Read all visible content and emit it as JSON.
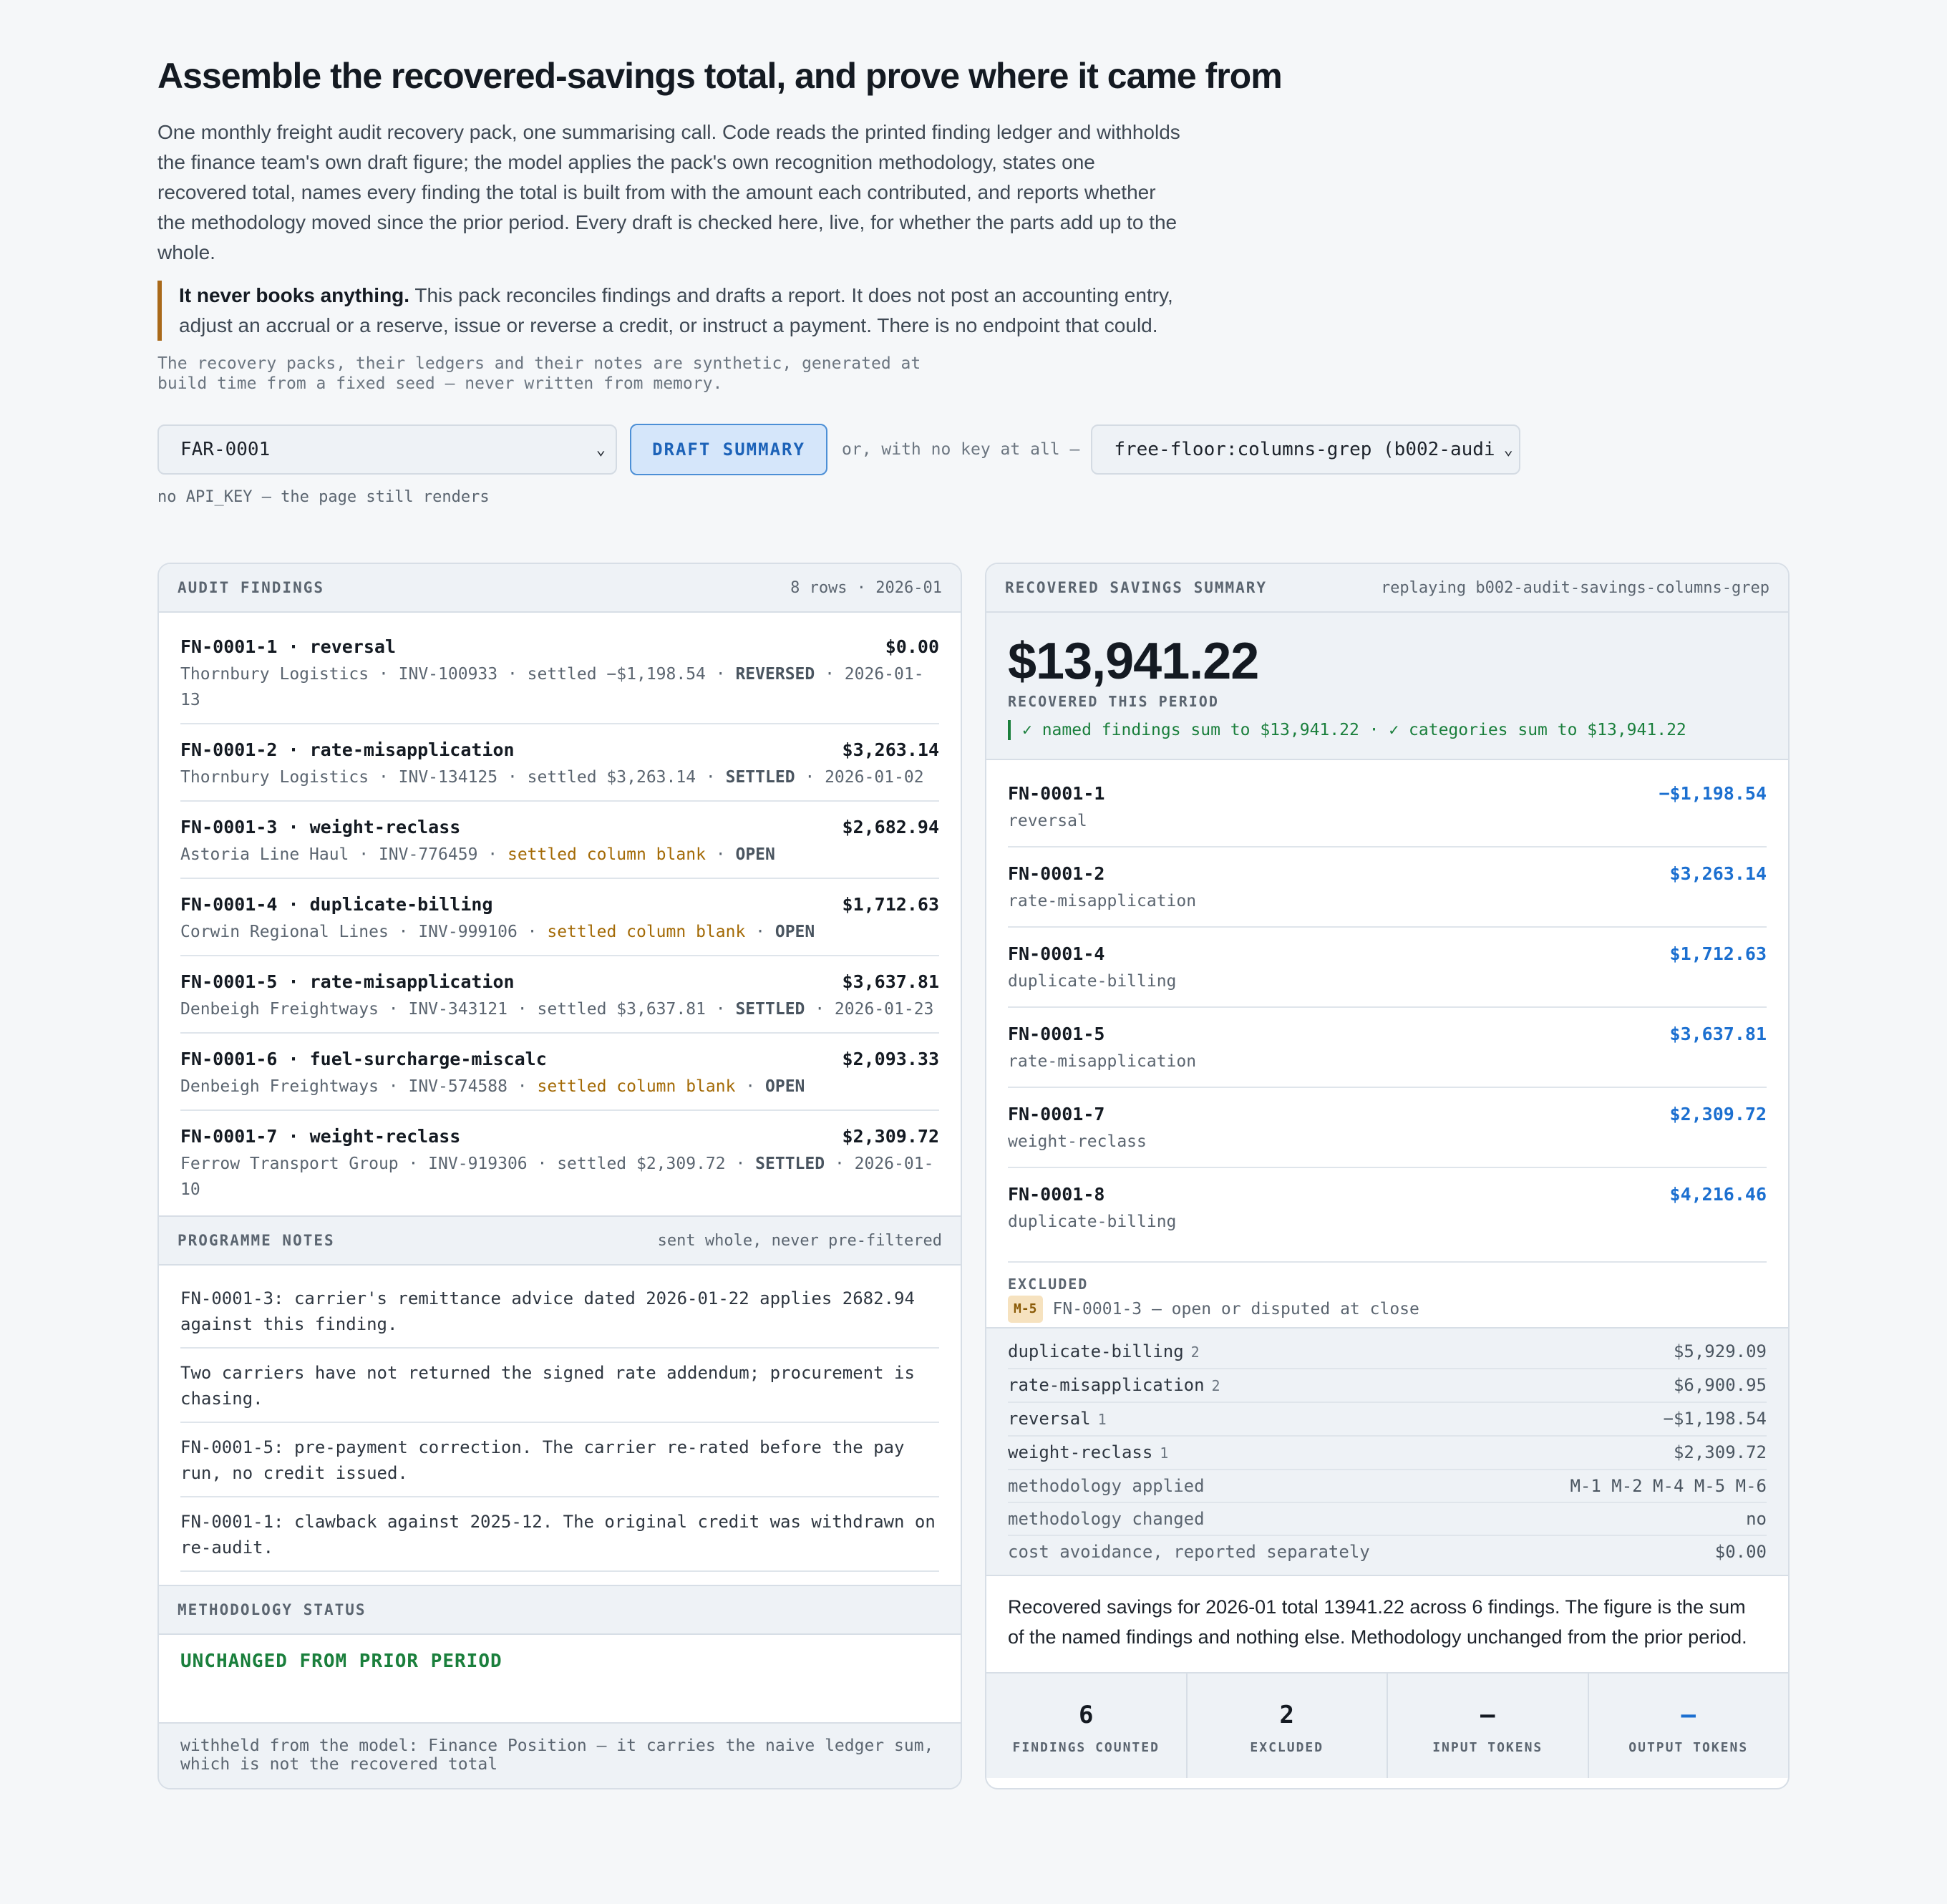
{
  "header": {
    "title": "Assemble the recovered-savings total, and prove where it came from",
    "intro": "One monthly freight audit recovery pack, one summarising call. Code reads the printed finding ledger and withholds the finance team's own draft figure; the model applies the pack's own recognition methodology, states one recovered total, names every finding the total is built from with the amount each contributed, and reports whether the methodology moved since the prior period. Every draft is checked here, live, for whether the parts add up to the whole.",
    "callout_bold": "It never books anything.",
    "callout_text": "This pack reconciles findings and drafts a report. It does not post an accounting entry, adjust an accrual or a reserve, issue or reverse a credit, or instruct a payment. There is no endpoint that could.",
    "seed_note": "The recovery packs, their ledgers and their notes are synthetic, generated at build time from a fixed seed — never written from memory."
  },
  "controls": {
    "pack_select": "FAR-0001",
    "draft_button": "DRAFT SUMMARY",
    "or_text": "or, with no key at all —",
    "replay_select": "free-floor:columns-grep (b002-audi",
    "no_key_note": "no API_KEY — the page still renders"
  },
  "findings": {
    "title": "AUDIT FINDINGS",
    "meta": "8 rows · 2026-01",
    "rows": [
      {
        "id_cat": "FN-0001-1 · reversal",
        "amount": "$0.00",
        "carrier": "Thornbury Logistics · INV-100933 · ",
        "settled": "settled −$1,198.54",
        "sep": " · ",
        "status": "REVERSED",
        "date": " · 2026-01-13"
      },
      {
        "id_cat": "FN-0001-2 · rate-misapplication",
        "amount": "$3,263.14",
        "carrier": "Thornbury Logistics · INV-134125 · ",
        "settled": "settled $3,263.14",
        "sep": " · ",
        "status": "SETTLED",
        "date": " · 2026-01-02"
      },
      {
        "id_cat": "FN-0001-3 · weight-reclass",
        "amount": "$2,682.94",
        "carrier": "Astoria Line Haul · INV-776459 · ",
        "blank": "settled column blank",
        "sep": " · ",
        "status": "OPEN",
        "date": ""
      },
      {
        "id_cat": "FN-0001-4 · duplicate-billing",
        "amount": "$1,712.63",
        "carrier": "Corwin Regional Lines · INV-999106 · ",
        "blank": "settled column blank",
        "sep": " · ",
        "status": "OPEN",
        "date": ""
      },
      {
        "id_cat": "FN-0001-5 · rate-misapplication",
        "amount": "$3,637.81",
        "carrier": "Denbeigh Freightways · INV-343121 · ",
        "settled": "settled $3,637.81",
        "sep": " · ",
        "status": "SETTLED",
        "date": " · 2026-01-23"
      },
      {
        "id_cat": "FN-0001-6 · fuel-surcharge-miscalc",
        "amount": "$2,093.33",
        "carrier": "Denbeigh Freightways · INV-574588 · ",
        "blank": "settled column blank",
        "sep": " · ",
        "status": "OPEN",
        "date": ""
      },
      {
        "id_cat": "FN-0001-7 · weight-reclass",
        "amount": "$2,309.72",
        "carrier": "Ferrow Transport Group · INV-919306 · ",
        "settled": "settled $2,309.72",
        "sep": " · ",
        "status": "SETTLED",
        "date": " · 2026-01-10"
      }
    ]
  },
  "notes": {
    "title": "PROGRAMME NOTES",
    "meta": "sent whole, never pre-filtered",
    "items": [
      "FN-0001-3: carrier's remittance advice dated 2026-01-22 applies 2682.94 against this finding.",
      "Two carriers have not returned the signed rate addendum; procurement is chasing.",
      "FN-0001-5: pre-payment correction. The carrier re-rated before the pay run, no credit issued.",
      "FN-0001-1: clawback against 2025-12. The original credit was withdrawn on re-audit."
    ]
  },
  "methodology": {
    "title": "METHODOLOGY STATUS",
    "status": "UNCHANGED FROM PRIOR PERIOD"
  },
  "withheld": "withheld from the model: Finance Position — it carries the naive ledger sum, which is not the recovered total",
  "summary": {
    "title": "RECOVERED SAVINGS SUMMARY",
    "meta": "replaying b002-audit-savings-columns-grep",
    "total": "$13,941.22",
    "total_label": "RECOVERED THIS PERIOD",
    "checks": "✓ named findings sum to $13,941.22 · ✓ categories sum to $13,941.22",
    "named": [
      {
        "id": "FN-0001-1",
        "amount": "−$1,198.54",
        "category": "reversal"
      },
      {
        "id": "FN-0001-2",
        "amount": "$3,263.14",
        "category": "rate-misapplication"
      },
      {
        "id": "FN-0001-4",
        "amount": "$1,712.63",
        "category": "duplicate-billing"
      },
      {
        "id": "FN-0001-5",
        "amount": "$3,637.81",
        "category": "rate-misapplication"
      },
      {
        "id": "FN-0001-7",
        "amount": "$2,309.72",
        "category": "weight-reclass"
      },
      {
        "id": "FN-0001-8",
        "amount": "$4,216.46",
        "category": "duplicate-billing"
      }
    ],
    "excluded_label": "EXCLUDED",
    "excluded_tag": "M-5",
    "excluded_text": "FN-0001-3 — open or disputed at close",
    "categories": [
      {
        "name": "duplicate-billing",
        "count": "2",
        "value": "$5,929.09"
      },
      {
        "name": "rate-misapplication",
        "count": "2",
        "value": "$6,900.95"
      },
      {
        "name": "reversal",
        "count": "1",
        "value": "−$1,198.54"
      },
      {
        "name": "weight-reclass",
        "count": "1",
        "value": "$2,309.72"
      }
    ],
    "facts": [
      {
        "name": "methodology applied",
        "value": "M-1 M-2 M-4 M-5 M-6"
      },
      {
        "name": "methodology changed",
        "value": "no"
      },
      {
        "name": "cost avoidance, reported separately",
        "value": "$0.00"
      }
    ],
    "prose": "Recovered savings for 2026-01 total 13941.22 across 6 findings. The figure is the sum of the named findings and nothing else. Methodology unchanged from the prior period.",
    "stats": [
      {
        "value": "6",
        "label": "FINDINGS COUNTED"
      },
      {
        "value": "2",
        "label": "EXCLUDED"
      },
      {
        "value": "—",
        "label": "INPUT TOKENS"
      },
      {
        "value": "—",
        "label": "OUTPUT TOKENS"
      }
    ]
  },
  "colors": {
    "accent_blue": "#1b6fd0",
    "ok_green": "#1a7f3c",
    "warn_amber": "#a36a06",
    "callout_border": "#a9691a"
  }
}
